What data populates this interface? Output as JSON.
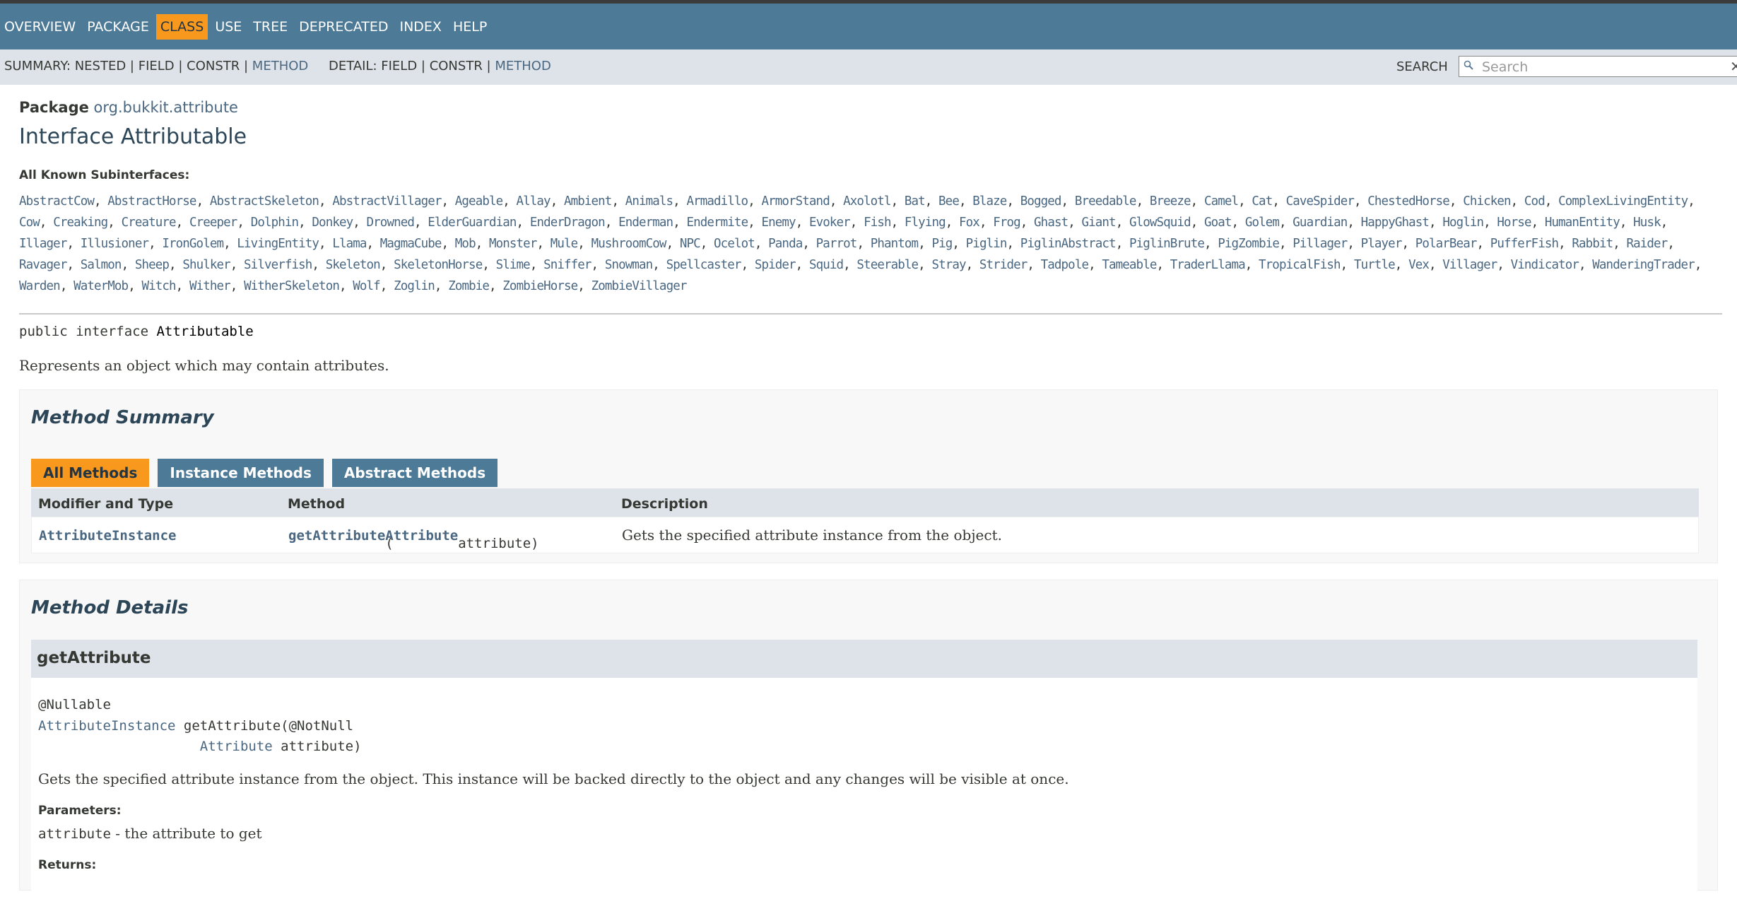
{
  "nav": {
    "items": [
      "OVERVIEW",
      "PACKAGE",
      "CLASS",
      "USE",
      "TREE",
      "DEPRECATED",
      "INDEX",
      "HELP"
    ],
    "active": "CLASS"
  },
  "subnav": {
    "summary_prefix": "SUMMARY: NESTED | FIELD | CONSTR | ",
    "summary_method": "METHOD",
    "detail_prefix": "DETAIL: FIELD | CONSTR | ",
    "detail_method": "METHOD",
    "search_label": "SEARCH",
    "search_placeholder": "Search"
  },
  "header": {
    "package_label": "Package",
    "package_name": "org.bukkit.attribute",
    "title": "Interface Attributable",
    "subinterfaces_label": "All Known Subinterfaces:",
    "subinterfaces": [
      "AbstractCow",
      "AbstractHorse",
      "AbstractSkeleton",
      "AbstractVillager",
      "Ageable",
      "Allay",
      "Ambient",
      "Animals",
      "Armadillo",
      "ArmorStand",
      "Axolotl",
      "Bat",
      "Bee",
      "Blaze",
      "Bogged",
      "Breedable",
      "Breeze",
      "Camel",
      "Cat",
      "CaveSpider",
      "ChestedHorse",
      "Chicken",
      "Cod",
      "ComplexLivingEntity",
      "Cow",
      "Creaking",
      "Creature",
      "Creeper",
      "Dolphin",
      "Donkey",
      "Drowned",
      "ElderGuardian",
      "EnderDragon",
      "Enderman",
      "Endermite",
      "Enemy",
      "Evoker",
      "Fish",
      "Flying",
      "Fox",
      "Frog",
      "Ghast",
      "Giant",
      "GlowSquid",
      "Goat",
      "Golem",
      "Guardian",
      "HappyGhast",
      "Hoglin",
      "Horse",
      "HumanEntity",
      "Husk",
      "Illager",
      "Illusioner",
      "IronGolem",
      "LivingEntity",
      "Llama",
      "MagmaCube",
      "Mob",
      "Monster",
      "Mule",
      "MushroomCow",
      "NPC",
      "Ocelot",
      "Panda",
      "Parrot",
      "Phantom",
      "Pig",
      "Piglin",
      "PiglinAbstract",
      "PiglinBrute",
      "PigZombie",
      "Pillager",
      "Player",
      "PolarBear",
      "PufferFish",
      "Rabbit",
      "Raider",
      "Ravager",
      "Salmon",
      "Sheep",
      "Shulker",
      "Silverfish",
      "Skeleton",
      "SkeletonHorse",
      "Slime",
      "Sniffer",
      "Snowman",
      "Spellcaster",
      "Spider",
      "Squid",
      "Steerable",
      "Stray",
      "Strider",
      "Tadpole",
      "Tameable",
      "TraderLlama",
      "TropicalFish",
      "Turtle",
      "Vex",
      "Villager",
      "Vindicator",
      "WanderingTrader",
      "Warden",
      "WaterMob",
      "Witch",
      "Wither",
      "WitherSkeleton",
      "Wolf",
      "Zoglin",
      "Zombie",
      "ZombieHorse",
      "ZombieVillager"
    ],
    "signature_prefix": "public interface ",
    "signature_name": "Attributable",
    "description": "Represents an object which may contain attributes."
  },
  "summary": {
    "heading": "Method Summary",
    "tabs": [
      "All Methods",
      "Instance Methods",
      "Abstract Methods"
    ],
    "columns": [
      "Modifier and Type",
      "Method",
      "Description"
    ],
    "rows": [
      {
        "type": "AttributeInstance",
        "method_name": "getAttribute",
        "method_open": "(",
        "param_type": "Attribute",
        "param_rest": " attribute)",
        "description": "Gets the specified attribute instance from the object."
      }
    ]
  },
  "details": {
    "heading": "Method Details",
    "method_name": "getAttribute",
    "annotation_nullable": "@Nullable",
    "return_type": "AttributeInstance",
    "sig_middle": " getAttribute(@NotNull",
    "param_type": "Attribute",
    "param_rest": " attribute)",
    "description": "Gets the specified attribute instance from the object. This instance will be backed directly to the object and any changes will be visible at once.",
    "parameters_label": "Parameters:",
    "param_code": "attribute",
    "param_desc": " - the attribute to get",
    "returns_label": "Returns:"
  }
}
